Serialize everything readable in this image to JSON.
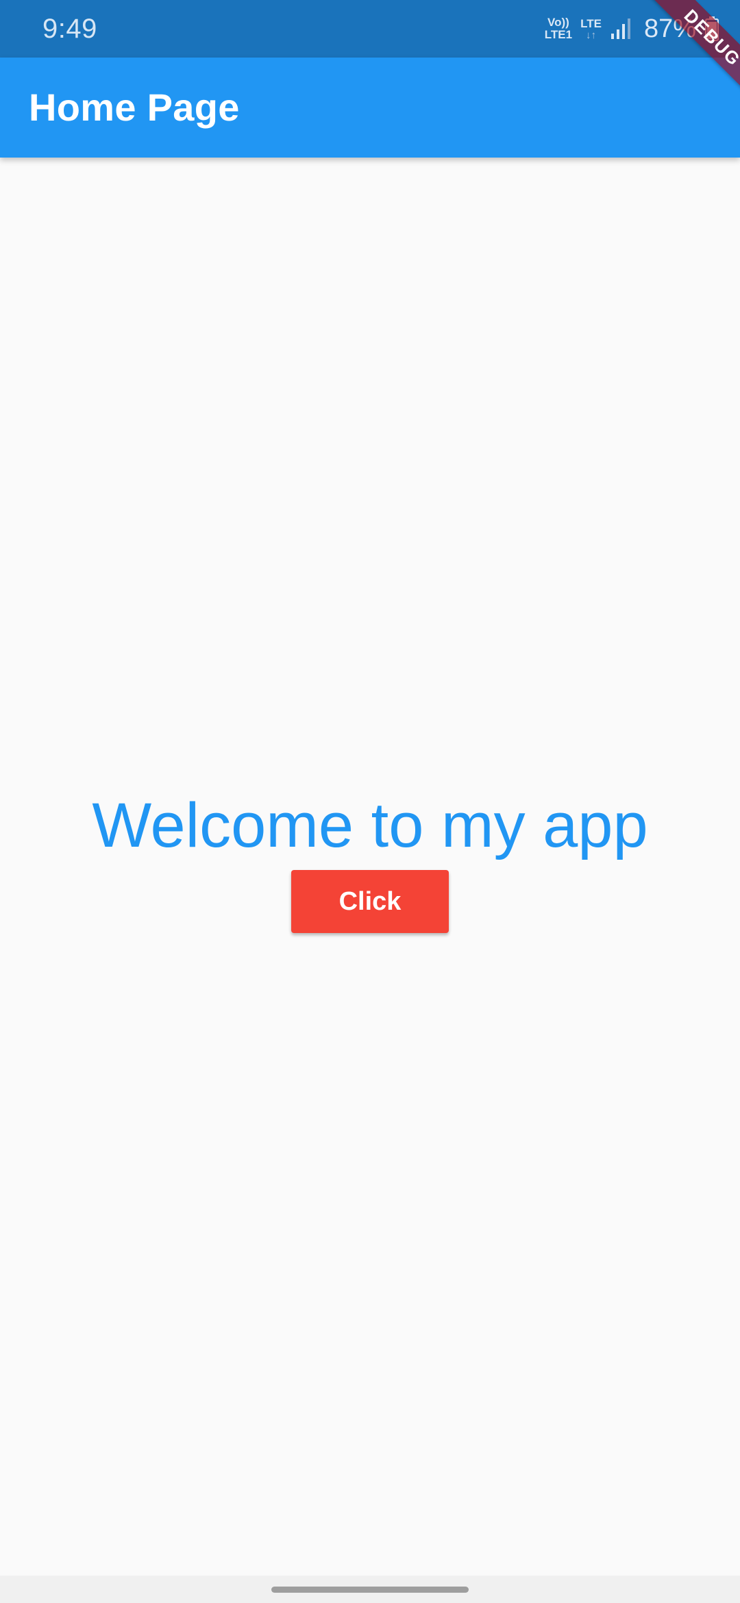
{
  "status_bar": {
    "time": "9:49",
    "volte_label": "Vo))",
    "lte1_label": "LTE1",
    "lte_label": "LTE",
    "data_arrows": "↓↑",
    "battery_percent": "87%",
    "icons": [
      "signal-icon",
      "battery-icon"
    ]
  },
  "debug_banner": {
    "label": "DEBUG",
    "color": "#a00010"
  },
  "app_bar": {
    "title": "Home Page",
    "color": "#2196f3"
  },
  "main": {
    "welcome_text": "Welcome to my app",
    "welcome_color": "#2196f3",
    "button_label": "Click",
    "button_color": "#f44336"
  },
  "nav_bar": {
    "icons": [
      "home-indicator"
    ]
  }
}
